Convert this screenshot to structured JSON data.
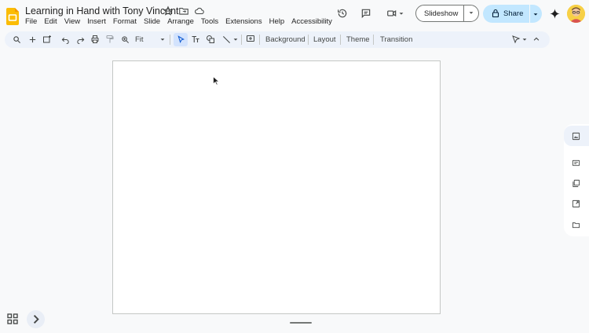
{
  "doc": {
    "title": "Learning in Hand with Tony Vincent"
  },
  "menu": [
    "File",
    "Edit",
    "View",
    "Insert",
    "Format",
    "Slide",
    "Arrange",
    "Tools",
    "Extensions",
    "Help",
    "Accessibility"
  ],
  "header": {
    "slideshow_label": "Slideshow",
    "share_label": "Share"
  },
  "toolbar": {
    "zoom_label": "Fit",
    "background_label": "Background",
    "layout_label": "Layout",
    "theme_label": "Theme",
    "transition_label": "Transition"
  },
  "colors": {
    "share_bg": "#c2e7ff",
    "toolbar_bg": "#edf2fa",
    "slides_logo": "#fbbc04",
    "selected": "#d3e3fd"
  }
}
